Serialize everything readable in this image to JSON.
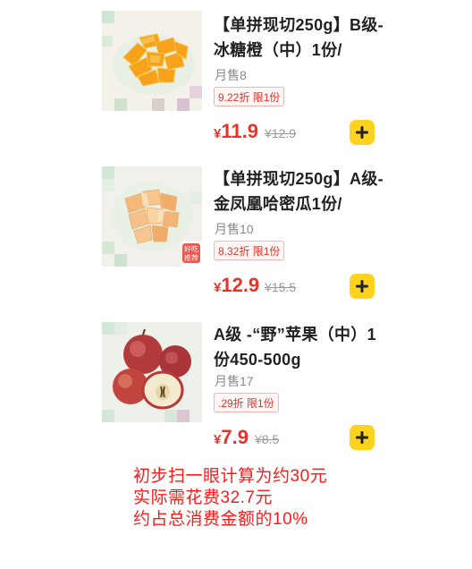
{
  "products": [
    {
      "title": "【单拼现切250g】B级-冰糖橙（中）1份/",
      "sales": "月售8",
      "discount_tag": "9.22折 限1份",
      "currency": "¥",
      "price": "11.9",
      "original_price": "¥12.9",
      "image": "orange-slices"
    },
    {
      "title": "【单拼现切250g】A级-金凤凰哈密瓜1份/",
      "sales": "月售10",
      "discount_tag": "8.32折 限1份",
      "currency": "¥",
      "price": "12.9",
      "original_price": "¥15.5",
      "image": "melon-cubes"
    },
    {
      "title": "A级 -“野”苹果（中）1份450-500g",
      "sales": "月售17",
      "discount_tag": ".29折 限1份",
      "currency": "¥",
      "price": "7.9",
      "original_price": "¥8.5",
      "image": "apples"
    }
  ],
  "add_button_icon": "plus-icon",
  "annotation": {
    "line1": "初步扫一眼计算为约30元",
    "line2": "实际需花费32.7元",
    "line3": "约占总消费金额的10%"
  },
  "colors": {
    "price_red": "#e8332a",
    "add_button_yellow": "#ffd21e",
    "annotation_red": "#ff1a1a"
  }
}
